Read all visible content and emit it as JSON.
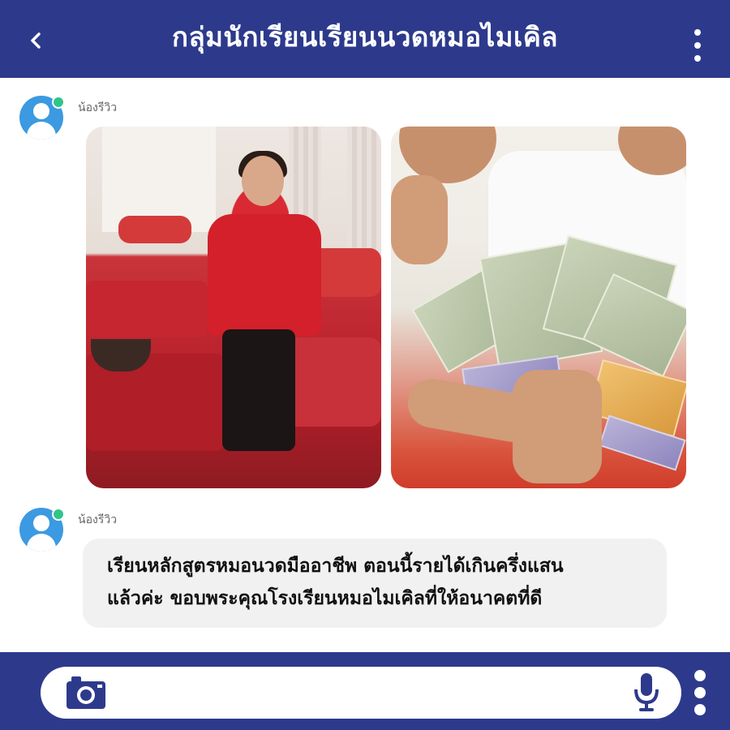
{
  "header": {
    "title": "กลุ่มนักเรียนเรียนนวดหมอไมเคิล",
    "back_icon": "chevron-left-icon",
    "more_icon": "more-vertical-icon",
    "background_color": "#2d3a8c"
  },
  "chat": {
    "messages": [
      {
        "sender": "น้องรีวิว",
        "type": "images",
        "avatar_icon": "user-avatar-icon",
        "online": true
      },
      {
        "sender": "น้องรีวิว",
        "type": "text",
        "avatar_icon": "user-avatar-icon",
        "online": true,
        "text_line1": "เรียนหลักสูตรหมอนวดมืออาชีพ ตอนนี้รายได้เกินครึ่งแสน",
        "text_line2": "แล้วค่ะ ขอบพระคุณโรงเรียนหมอไมเคิลที่ให้อนาคตที่ดี"
      }
    ],
    "bubble_color": "#f1f1f1",
    "avatar_color": "#3b9ae1",
    "online_color": "#2fc58a"
  },
  "composer": {
    "camera_icon": "camera-icon",
    "mic_icon": "microphone-icon",
    "more_icon": "more-vertical-icon",
    "background_color": "#2d3a8c"
  }
}
